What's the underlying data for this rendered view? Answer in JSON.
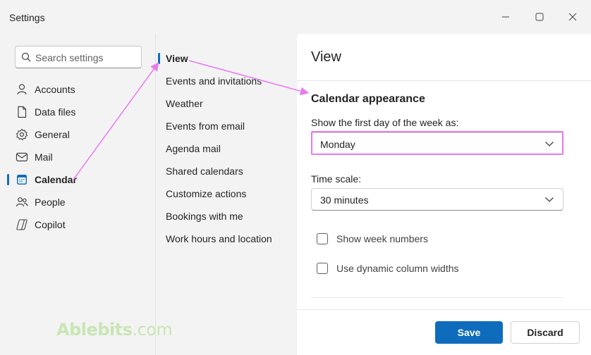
{
  "window": {
    "title": "Settings",
    "controls": [
      "minimize-icon",
      "maximize-icon",
      "close-icon"
    ]
  },
  "search": {
    "placeholder": "Search settings",
    "icon": "search-icon"
  },
  "left_nav": {
    "items": [
      {
        "label": "Accounts",
        "icon": "person-icon"
      },
      {
        "label": "Data files",
        "icon": "document-icon"
      },
      {
        "label": "General",
        "icon": "gear-icon"
      },
      {
        "label": "Mail",
        "icon": "mail-icon"
      },
      {
        "label": "Calendar",
        "icon": "calendar-icon",
        "active": true
      },
      {
        "label": "People",
        "icon": "people-icon"
      },
      {
        "label": "Copilot",
        "icon": "copilot-icon"
      }
    ]
  },
  "sub_nav": {
    "items": [
      {
        "label": "View",
        "active": true
      },
      {
        "label": "Events and invitations"
      },
      {
        "label": "Weather"
      },
      {
        "label": "Events from email"
      },
      {
        "label": "Agenda mail"
      },
      {
        "label": "Shared calendars"
      },
      {
        "label": "Customize actions"
      },
      {
        "label": "Bookings with me"
      },
      {
        "label": "Work hours and location"
      }
    ]
  },
  "content": {
    "title": "View",
    "section_title": "Calendar appearance",
    "first_day": {
      "label": "Show the first day of the week as:",
      "value": "Monday"
    },
    "time_scale": {
      "label": "Time scale:",
      "value": "30 minutes"
    },
    "checkboxes": [
      {
        "label": "Show week numbers",
        "checked": false
      },
      {
        "label": "Use dynamic column widths",
        "checked": false
      }
    ]
  },
  "footer": {
    "save_label": "Save",
    "discard_label": "Discard"
  },
  "watermark": {
    "brand": "Ablebits",
    "suffix": ".com"
  },
  "colors": {
    "accent": "#0f6cbd",
    "annotation": "#e878f0",
    "watermark": "#c8e6b4"
  }
}
